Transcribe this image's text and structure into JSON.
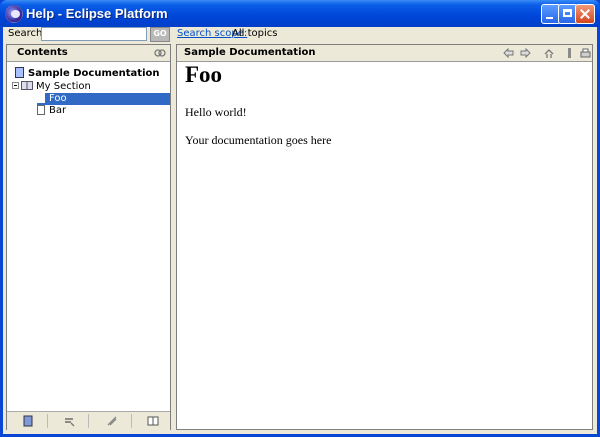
{
  "window": {
    "title": "Help - Eclipse Platform"
  },
  "search": {
    "label": "Search:",
    "value": "",
    "placeholder": "",
    "go_label": "GO",
    "scope_link": "Search scope:",
    "scope_value": "All topics"
  },
  "contents": {
    "title": "Contents",
    "tree": {
      "root": "Sample Documentation",
      "section": "My Section",
      "items": [
        {
          "label": "Foo",
          "selected": true
        },
        {
          "label": "Bar",
          "selected": false
        }
      ]
    }
  },
  "topic": {
    "header": "Sample Documentation",
    "heading": "Foo",
    "paragraphs": [
      "Hello world!",
      "Your documentation goes here"
    ]
  },
  "icons": {
    "toolbar": [
      "back-icon",
      "forward-icon",
      "sync-toc-icon",
      "bookmark-icon",
      "print-icon"
    ],
    "footer": [
      "contents-icon",
      "links-icon",
      "bookmarks-icon",
      "index-icon"
    ],
    "link": "link-with-contents-icon"
  },
  "colors": {
    "title_bar": "#0054e3",
    "selection": "#316ac5",
    "link": "#0050c8"
  }
}
